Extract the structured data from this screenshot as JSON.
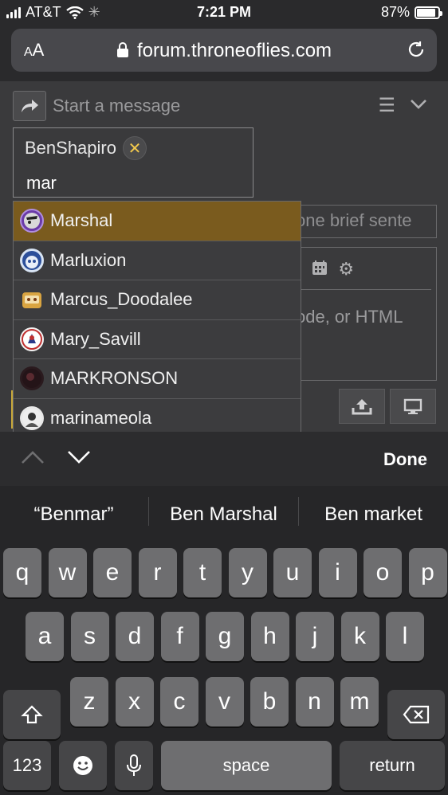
{
  "status_bar": {
    "carrier": "AT&T",
    "time": "7:21 PM",
    "battery": "87%",
    "battery_level": 0.87
  },
  "browser": {
    "text_size_label": "AA",
    "url": "forum.throneoflies.com"
  },
  "composer": {
    "title": "Start a message",
    "recipient_chip": "BenShapiro",
    "recipient_input": "mar",
    "subject_placeholder": "one brief sente",
    "editor_hint": "ode, or HTML"
  },
  "autocomplete": {
    "options": [
      {
        "name": "Marshal",
        "selected": true
      },
      {
        "name": "Marluxion",
        "selected": false
      },
      {
        "name": "Marcus_Doodalee",
        "selected": false
      },
      {
        "name": "Mary_Savill",
        "selected": false
      },
      {
        "name": "MARKRONSON",
        "selected": false
      },
      {
        "name": "marinameola",
        "selected": false
      }
    ]
  },
  "accessory": {
    "done_label": "Done"
  },
  "keyboard": {
    "suggestions": [
      "“Benmar”",
      "Ben Marshal",
      "Ben market"
    ],
    "row1": [
      "q",
      "w",
      "e",
      "r",
      "t",
      "y",
      "u",
      "i",
      "o",
      "p"
    ],
    "row2": [
      "a",
      "s",
      "d",
      "f",
      "g",
      "h",
      "j",
      "k",
      "l"
    ],
    "row3": [
      "z",
      "x",
      "c",
      "v",
      "b",
      "n",
      "m"
    ],
    "numbers_label": "123",
    "space_label": "space",
    "return_label": "return"
  },
  "colors": {
    "selected_option": "#7a5b1e",
    "remove_chip": "#f2c94c"
  }
}
